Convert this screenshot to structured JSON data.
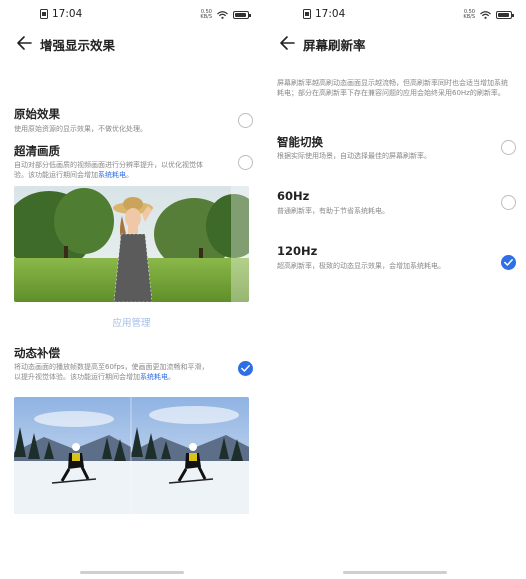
{
  "left": {
    "status": {
      "time": "17:04",
      "speed_top": "0.50",
      "speed_bottom": "KB/S"
    },
    "title": "增强显示效果",
    "options": [
      {
        "title": "原始效果",
        "desc": "使用原始资源的显示效果，不做优化处理。",
        "checked": false
      },
      {
        "title": "超清画质",
        "desc": "自动对部分低画质的视频画面进行分辨率提升，以优化视觉体验。该功能运行期间会增加",
        "link": "系统耗电",
        "tail": "。",
        "checked": false
      },
      {
        "title": "动态补偿",
        "desc": "将动态画面的播放帧数提高至60fps，使画面更加流畅和平滑，以提升视觉体验。该功能运行期间会增加",
        "link": "系统耗电",
        "tail": "。",
        "checked": true
      }
    ],
    "app_manage": "应用管理"
  },
  "right": {
    "status": {
      "time": "17:04",
      "speed_top": "0.50",
      "speed_bottom": "KB/S"
    },
    "title": "屏幕刷新率",
    "intro": "屏幕刷新率越高刷动态画面显示越流畅，但高刷新率同时也会适当增加系统耗电；部分在高刷新率下存在兼容问题的应用会始终采用60Hz的刷新率。",
    "options": [
      {
        "title": "智能切换",
        "desc": "根据实际使用场景，自动选择最佳的屏幕刷新率。",
        "checked": false
      },
      {
        "title": "60Hz",
        "desc": "普通刷新率，有助于节省系统耗电。",
        "checked": false
      },
      {
        "title": "120Hz",
        "desc": "超高刷新率，极致的动态显示效果，会增加系统耗电。",
        "checked": true
      }
    ]
  },
  "colors": {
    "accent": "#2e6ee6",
    "link": "#2d6cdf"
  }
}
